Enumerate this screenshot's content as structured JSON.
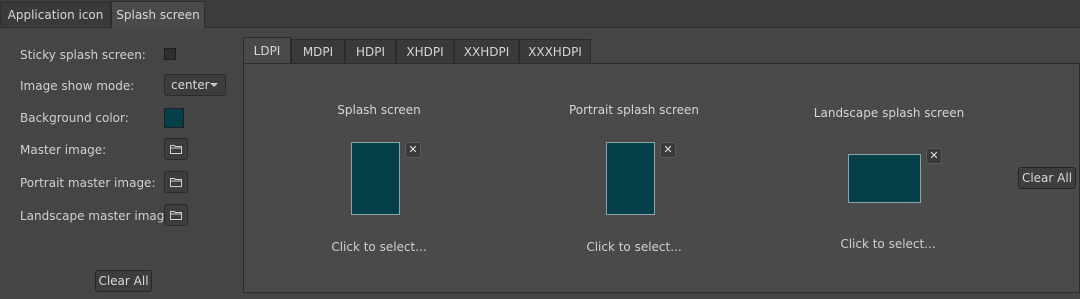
{
  "top_tabs": [
    {
      "label": "Application icon"
    },
    {
      "label": "Splash screen"
    }
  ],
  "left": {
    "sticky_label": "Sticky splash screen:",
    "mode_label": "Image show mode:",
    "mode_value": "center",
    "bg_label": "Background color:",
    "bg_color": "#053f4a",
    "master_label": "Master image:",
    "portrait_label": "Portrait master image:",
    "landscape_label": "Landscape master image:",
    "clear_all": "Clear All"
  },
  "density_tabs": [
    "LDPI",
    "MDPI",
    "HDPI",
    "XHDPI",
    "XXHDPI",
    "XXXHDPI"
  ],
  "columns": [
    {
      "title": "Splash screen",
      "action": "Click to select..."
    },
    {
      "title": "Portrait splash screen",
      "action": "Click to select..."
    },
    {
      "title": "Landscape splash screen",
      "action": "Click to select..."
    }
  ],
  "right_clear_all": "Clear All",
  "icons": {
    "close": "close-icon",
    "folder": "folder-icon",
    "caret": "chevron-down-icon"
  }
}
